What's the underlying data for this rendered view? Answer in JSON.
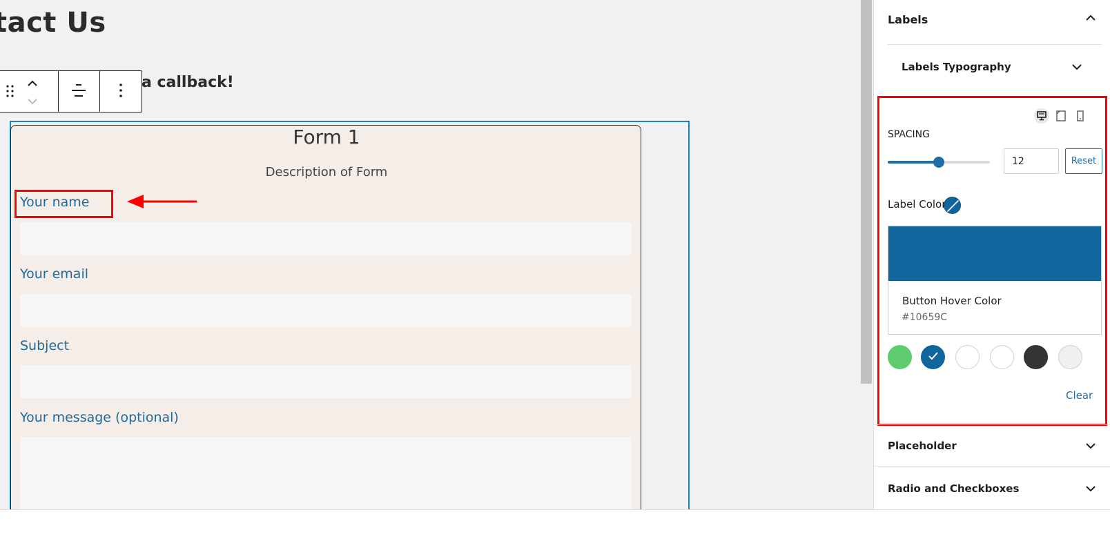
{
  "canvas": {
    "page_title": "ntact Us",
    "callback_text": "a callback!",
    "toolbar": {
      "drag_icon": "drag-handle-icon",
      "move_up_icon": "chevron-up-icon",
      "move_down_icon": "chevron-down-icon",
      "align_icon": "align-icon",
      "more_icon": "more-options-icon"
    },
    "form": {
      "title": "Form 1",
      "description": "Description of Form",
      "fields": [
        {
          "label": "Your name"
        },
        {
          "label": "Your email"
        },
        {
          "label": "Subject"
        },
        {
          "label": "Your message (optional)"
        }
      ]
    },
    "annotation_color": "#ff0000"
  },
  "sidebar": {
    "labels_section": "Labels",
    "labels_typography": "Labels Typography",
    "devices": [
      "desktop-icon",
      "tablet-icon",
      "mobile-icon"
    ],
    "spacing": {
      "label": "SPACING",
      "value": "12",
      "slider_fraction": 0.5,
      "reset_label": "Reset"
    },
    "label_color": {
      "label": "Label Color",
      "picker_name": "Button Hover Color",
      "picker_hex": "#10659C",
      "value": "#10659c"
    },
    "swatches": [
      {
        "color": "#5ecb6f",
        "selected": false
      },
      {
        "color": "#10659c",
        "selected": true
      },
      {
        "color": "#ffffff",
        "selected": false
      },
      {
        "color": "#ffffff",
        "selected": false
      },
      {
        "color": "#333333",
        "selected": false
      },
      {
        "color": "#f0f0f0",
        "selected": false
      }
    ],
    "clear_label": "Clear",
    "placeholder_section": "Placeholder",
    "radio_section": "Radio and Checkboxes"
  }
}
